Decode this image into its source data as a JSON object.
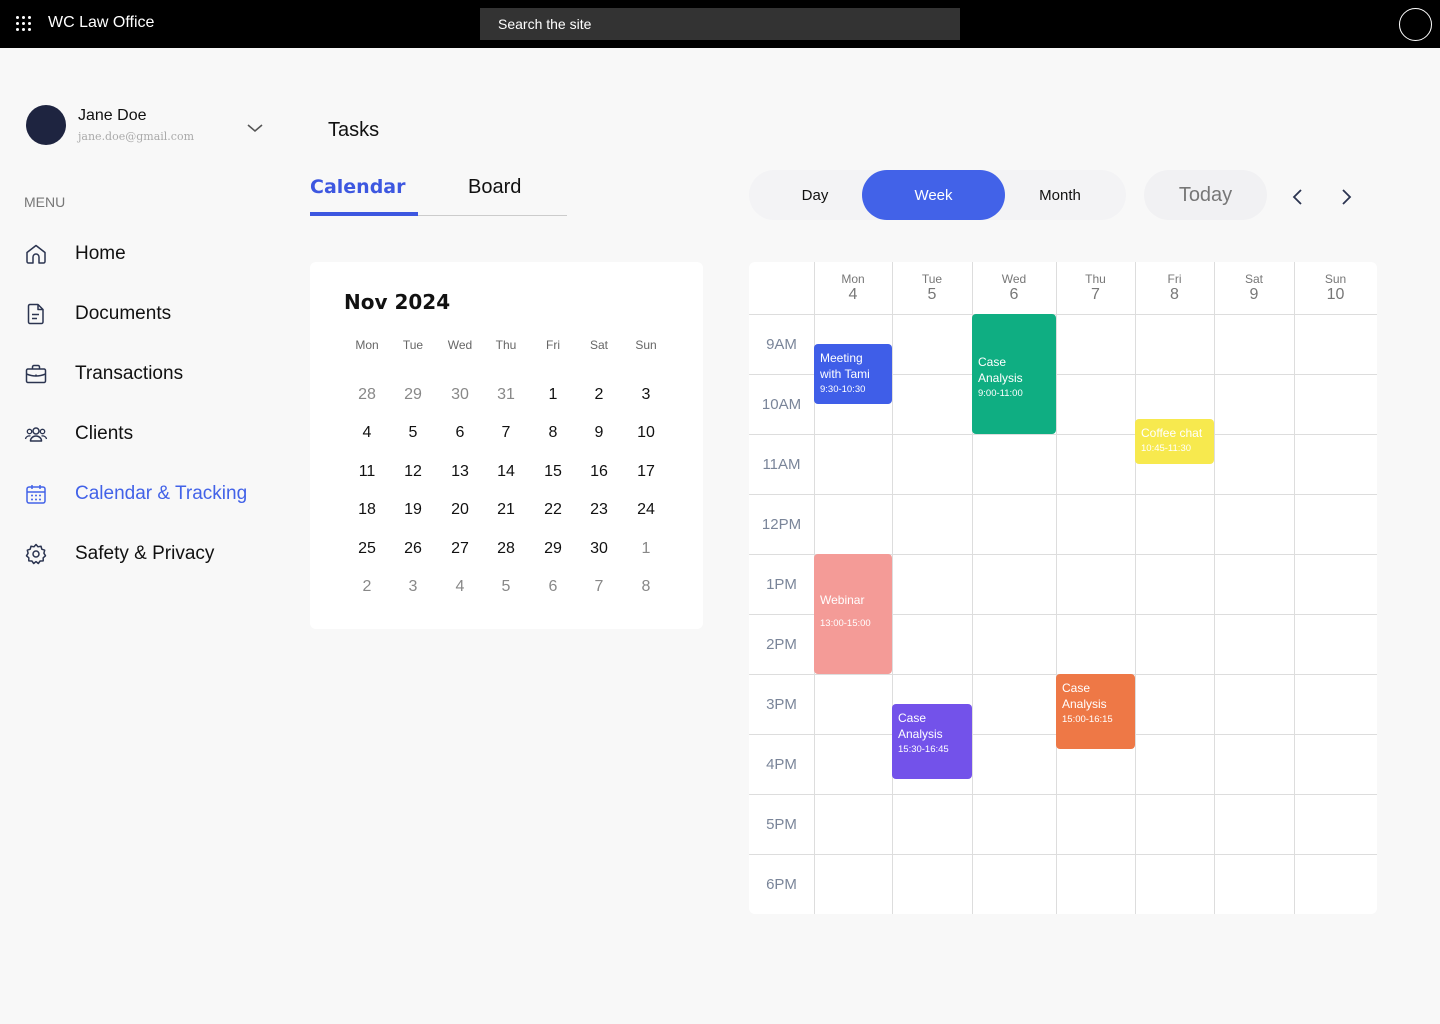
{
  "topbar": {
    "brand": "WC Law Office",
    "search_placeholder": "Search the site"
  },
  "user": {
    "name": "Jane Doe",
    "email": "jane.doe@gmail.com"
  },
  "sidebar": {
    "menu_label": "MENU",
    "items": [
      {
        "label": "Home",
        "icon": "home-icon"
      },
      {
        "label": "Documents",
        "icon": "document-icon"
      },
      {
        "label": "Transactions",
        "icon": "briefcase-icon"
      },
      {
        "label": "Clients",
        "icon": "clients-icon"
      },
      {
        "label": "Calendar & Tracking",
        "icon": "calendar-icon",
        "active": true
      },
      {
        "label": "Safety & Privacy",
        "icon": "gear-icon"
      }
    ]
  },
  "tasks": {
    "title": "Tasks",
    "tabs": [
      "Calendar",
      "Board"
    ],
    "active_tab": "Calendar"
  },
  "view": {
    "options": [
      "Day",
      "Week",
      "Month"
    ],
    "selected": "Week",
    "today_label": "Today"
  },
  "mini_calendar": {
    "title": "Nov 2024",
    "dow": [
      "Mon",
      "Tue",
      "Wed",
      "Thu",
      "Fri",
      "Sat",
      "Sun"
    ],
    "weeks": [
      [
        "28",
        "29",
        "30",
        "31",
        "1",
        "2",
        "3"
      ],
      [
        "4",
        "5",
        "6",
        "7",
        "8",
        "9",
        "10"
      ],
      [
        "11",
        "12",
        "13",
        "14",
        "15",
        "16",
        "17"
      ],
      [
        "18",
        "19",
        "20",
        "21",
        "22",
        "23",
        "24"
      ],
      [
        "25",
        "26",
        "27",
        "28",
        "29",
        "30",
        "1"
      ],
      [
        "2",
        "3",
        "4",
        "5",
        "6",
        "7",
        "8"
      ]
    ]
  },
  "week": {
    "days": [
      {
        "name": "Mon",
        "num": "4"
      },
      {
        "name": "Tue",
        "num": "5"
      },
      {
        "name": "Wed",
        "num": "6"
      },
      {
        "name": "Thu",
        "num": "7"
      },
      {
        "name": "Fri",
        "num": "8"
      },
      {
        "name": "Sat",
        "num": "9"
      },
      {
        "name": "Sun",
        "num": "10"
      }
    ],
    "hours": [
      "9AM",
      "10AM",
      "11AM",
      "12PM",
      "1PM",
      "2PM",
      "3PM",
      "4PM",
      "5PM",
      "6PM"
    ],
    "events": [
      {
        "title": "Meeting with Tami",
        "time": "9:30-10:30",
        "day": 0,
        "color": "#3f5ee8"
      },
      {
        "title": "Case Analysis",
        "time": "9:00-11:00",
        "day": 2,
        "color": "#0fae82"
      },
      {
        "title": "Coffee chat",
        "time": "10:45-11:30",
        "day": 4,
        "color": "#f7e94e"
      },
      {
        "title": "Webinar",
        "time": "13:00-15:00",
        "day": 0,
        "color": "#f49b97"
      },
      {
        "title": "Case Analysis",
        "time": "15:30-16:45",
        "day": 1,
        "color": "#7352ea"
      },
      {
        "title": "Case Analysis",
        "time": "15:00-16:15",
        "day": 3,
        "color": "#ee7846"
      }
    ]
  }
}
